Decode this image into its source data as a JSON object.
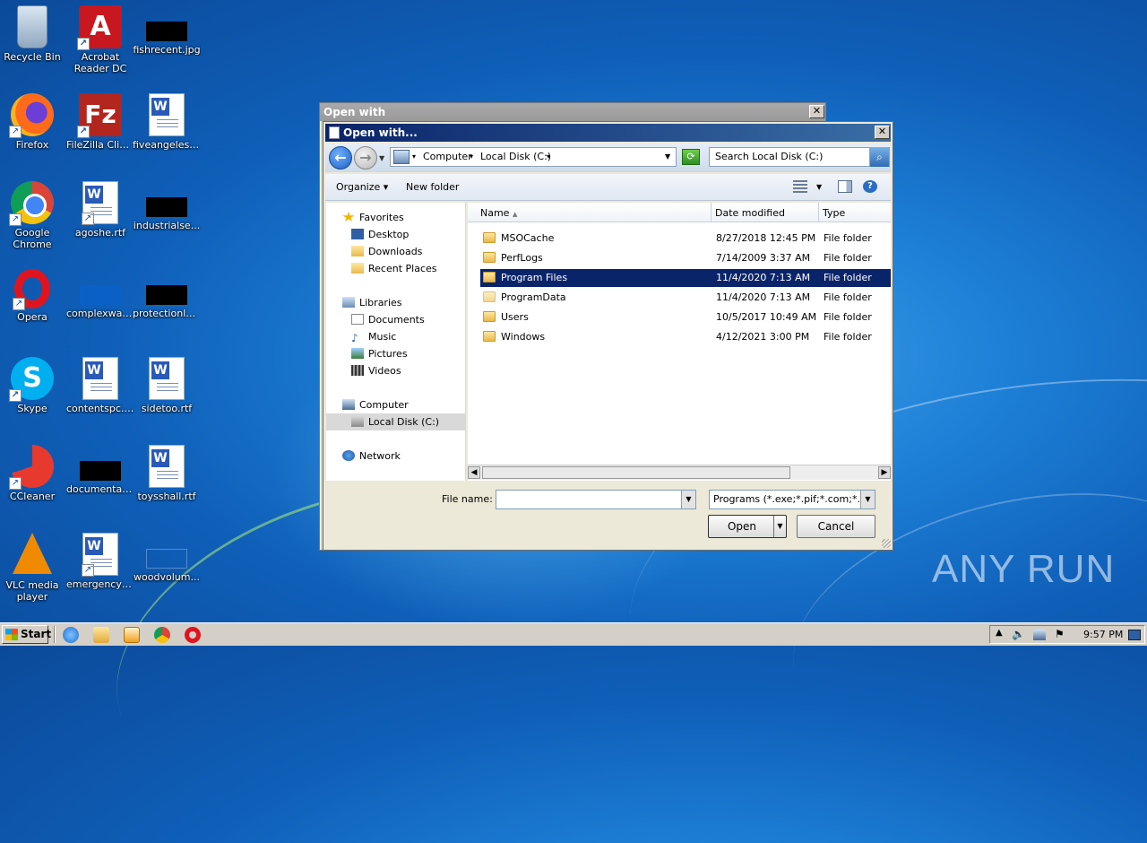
{
  "desktop": {
    "icons": [
      {
        "label": "Recycle Bin",
        "icon": "recycle-bin-icon"
      },
      {
        "label": "Acrobat Reader DC",
        "icon": "acrobat-icon"
      },
      {
        "label": "fishrecent.jpg",
        "icon": "image-file-icon"
      },
      {
        "label": "Firefox",
        "icon": "firefox-icon"
      },
      {
        "label": "FileZilla Client",
        "icon": "filezilla-icon"
      },
      {
        "label": "fiveangeles.rtf",
        "icon": "word-document-icon"
      },
      {
        "label": "Google Chrome",
        "icon": "chrome-icon"
      },
      {
        "label": "agoshe.rtf",
        "icon": "word-document-icon"
      },
      {
        "label": "industrialse...",
        "icon": "image-file-icon"
      },
      {
        "label": "Opera",
        "icon": "opera-icon"
      },
      {
        "label": "complexwat...",
        "icon": "file-icon"
      },
      {
        "label": "protectionlo...",
        "icon": "image-file-icon"
      },
      {
        "label": "Skype",
        "icon": "skype-icon"
      },
      {
        "label": "contentspc.rtf",
        "icon": "word-document-icon"
      },
      {
        "label": "sidetoo.rtf",
        "icon": "word-document-icon"
      },
      {
        "label": "CCleaner",
        "icon": "ccleaner-icon"
      },
      {
        "label": "documentati...",
        "icon": "image-file-icon"
      },
      {
        "label": "toysshall.rtf",
        "icon": "word-document-icon"
      },
      {
        "label": "VLC media player",
        "icon": "vlc-icon"
      },
      {
        "label": "emergencyh...",
        "icon": "word-document-icon"
      },
      {
        "label": "woodvolum...",
        "icon": "file-icon"
      }
    ],
    "watermark": "ANY RUN"
  },
  "back_window": {
    "title": "Open with",
    "close": "✕"
  },
  "dialog": {
    "title": "Open with...",
    "close": "✕",
    "address": {
      "crumbs": [
        "Computer",
        "Local Disk (C:)"
      ]
    },
    "search_placeholder": "Search Local Disk (C:)",
    "toolbar": {
      "organize": "Organize",
      "new_folder": "New folder"
    },
    "nav": {
      "favorites": "Favorites",
      "desktop": "Desktop",
      "downloads": "Downloads",
      "recent": "Recent Places",
      "libraries": "Libraries",
      "documents": "Documents",
      "music": "Music",
      "pictures": "Pictures",
      "videos": "Videos",
      "computer": "Computer",
      "local_disk": "Local Disk (C:)",
      "network": "Network"
    },
    "columns": {
      "name": "Name",
      "date": "Date modified",
      "type": "Type"
    },
    "rows": [
      {
        "name": "MSOCache",
        "date": "8/27/2018 12:45 PM",
        "type": "File folder"
      },
      {
        "name": "PerfLogs",
        "date": "7/14/2009 3:37 AM",
        "type": "File folder"
      },
      {
        "name": "Program Files",
        "date": "11/4/2020 7:13 AM",
        "type": "File folder"
      },
      {
        "name": "ProgramData",
        "date": "11/4/2020 7:13 AM",
        "type": "File folder"
      },
      {
        "name": "Users",
        "date": "10/5/2017 10:49 AM",
        "type": "File folder"
      },
      {
        "name": "Windows",
        "date": "4/12/2021 3:00 PM",
        "type": "File folder"
      }
    ],
    "file_name_label": "File name:",
    "file_name_value": "",
    "filter": "Programs (*.exe;*.pif;*.com;*.ba",
    "open": "Open",
    "cancel": "Cancel"
  },
  "taskbar": {
    "start": "Start",
    "clock": "9:57 PM"
  },
  "colors": {
    "selection": "#0a246a",
    "title_active": "#0a246a",
    "desktop": "#1d7fd6"
  }
}
